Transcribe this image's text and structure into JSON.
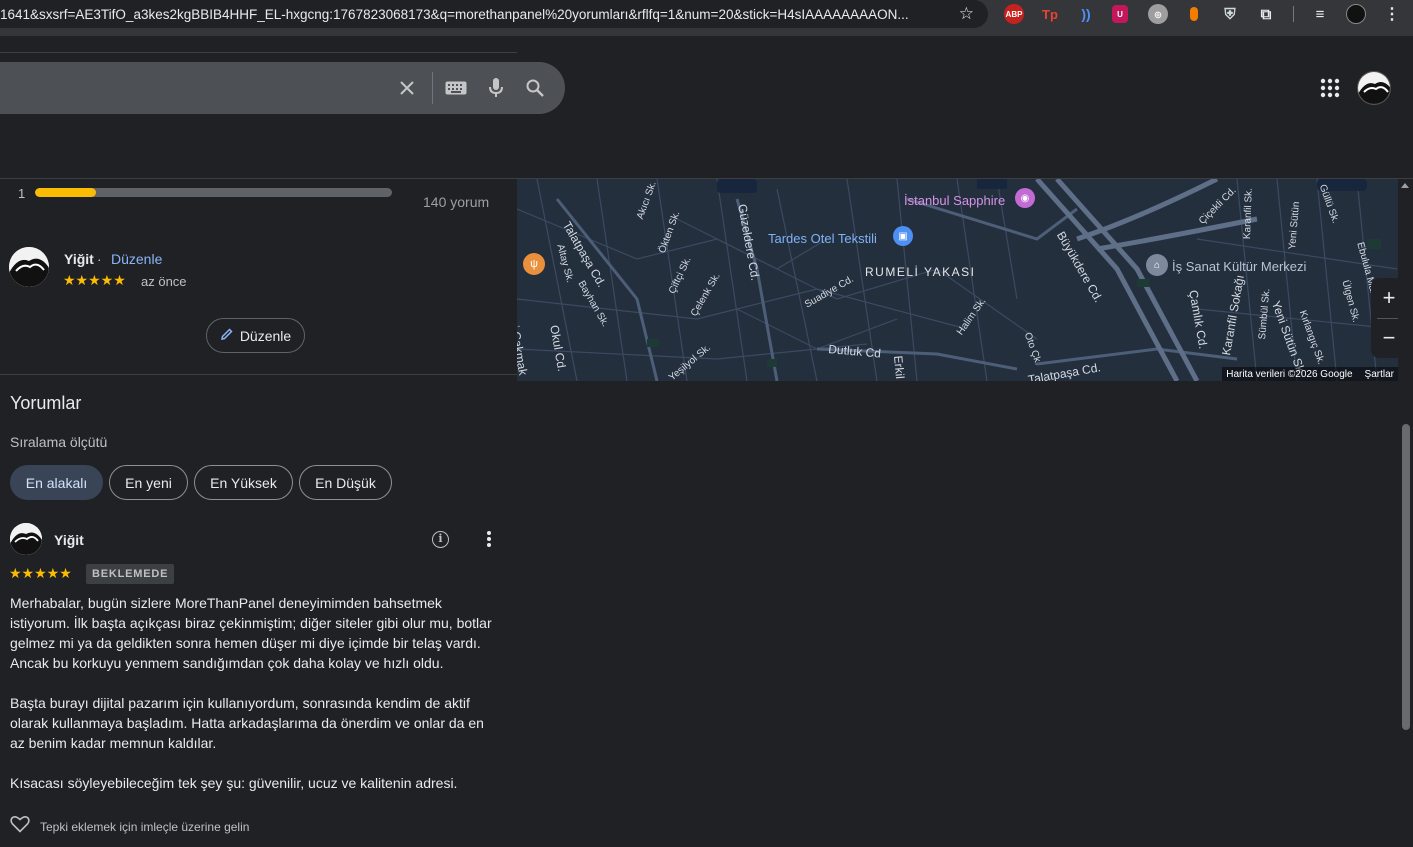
{
  "browser": {
    "url": "1641&sxsrf=AE3TifO_a3kes2kgBBIB4HHF_EL-hxgcng:1767823068173&q=morethanpanel%20yorumları&rflfq=1&num=20&stick=H4sIAAAAAAAAON...",
    "extensions": [
      "abp-icon",
      "tp-icon",
      "wifi-icon",
      "ublock-icon",
      "glasses-icon",
      "drop-icon",
      "shield-icon",
      "puzzle-icon",
      "media-icon",
      "profile-icon",
      "menu-dots-icon"
    ],
    "abp_label": "ABP",
    "tp_label": "Tp"
  },
  "search": {
    "clear_icon": "close-icon",
    "keyboard_icon": "keyboard-icon",
    "mic_icon": "mic-icon",
    "search_icon": "search-icon"
  },
  "rating_summary": {
    "star_level": "1",
    "fill_fraction": 0.17,
    "review_count": "140 yorum",
    "bar_color": "#fbbc04"
  },
  "my_review": {
    "name": "Yiğit",
    "separator": "·",
    "edit_link": "Düzenle",
    "stars": "★★★★★",
    "time": "az önce",
    "edit_button": "Düzenle"
  },
  "reviews": {
    "title": "Yorumlar",
    "sort_label": "Sıralama ölçütü",
    "chips": [
      "En alakalı",
      "En yeni",
      "En Yüksek",
      "En Düşük"
    ],
    "active_chip": "En alakalı",
    "item": {
      "name": "Yiğit",
      "stars": "★★★★★",
      "badge": "BEKLEMEDE",
      "paragraphs": [
        "Merhabalar, bugün sizlere MoreThanPanel deneyimimden bahsetmek istiyorum. İlk başta açıkçası biraz çekinmiştim; diğer siteler gibi olur mu, botlar gelmez mi ya da geldikten sonra hemen düşer mi diye içimde bir telaş vardı. Ancak bu korkuyu yenmem sandığımdan çok daha kolay ve hızlı oldu.",
        "Başta burayı dijital pazarım için kullanıyordum, sonrasında kendim de aktif olarak kullanmaya başladım. Hatta arkadaşlarıma da önerdim ve onlar da en az benim kadar memnun kaldılar.",
        "Kısacası söyleyebileceğim tek şey şu: güvenilir, ucuz ve kalitenin adresi."
      ],
      "reaction_hint": "Tepki eklemek için imleçle üzerine gelin"
    }
  },
  "map": {
    "pois": [
      "İstanbul Sapphire",
      "Tardes Otel Tekstili",
      "İş Sanat Kültür Merkezi"
    ],
    "area": "RUMELİ YAKASI",
    "streets": [
      "Talatpaşa Cd.",
      "Akıcı Sk.",
      "Altay Sk.",
      "Bayhan Sk.",
      "Ökten Sk.",
      "Çiftçi Sk.",
      "Çelenk Sk.",
      "Güzeldere Cd.",
      "Suadiye Cd.",
      "Halim Sk.",
      "Dutluk Cd",
      "Oto Çk.",
      "Talatpaşa Cd.",
      "Büyükdere Cd.",
      "Çamlık Cd.",
      "Karanfil Sokağı",
      "Sümbül Sk.",
      "Yeni Sütün Sk.",
      "Fevzi Çakmak",
      "Okul Cd.",
      "Erkil",
      "Çiçekli Cd.",
      "Ebulula Mardin",
      "Yeni Sütün",
      "Güllü Sk.",
      "Ülgen Sk.",
      "Karanfil Sk.",
      "Kırlangıç Sk.",
      "Yeşilyol Sk."
    ],
    "attribution": "Harita verileri ©2026 Google",
    "terms": "Şartlar",
    "zoom_in": "+",
    "zoom_out": "−",
    "bg_color": "#242f3e"
  }
}
